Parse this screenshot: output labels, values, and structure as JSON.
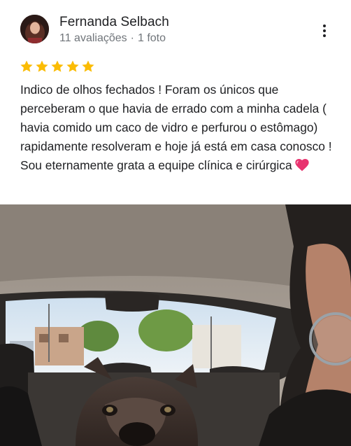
{
  "review": {
    "author_name": "Fernanda Selbach",
    "review_count": "11 avaliações",
    "separator": "·",
    "photo_count": "1 foto",
    "rating": 5,
    "max_rating": 5,
    "text": "Indico de olhos fechados ! Foram os únicos que perceberam o que havia de errado com a minha cadela ( havia comido um caco de vidro e perfurou o estômago) rapidamente resolveram e hoje já está em casa conosco ! Sou eternamente grata a equipe clínica e cirúrgica",
    "emoji": "heart-icon"
  },
  "icons": {
    "more": "more-vert-icon",
    "star": "star-icon",
    "heart": "heart-icon"
  },
  "colors": {
    "star": "#fbbc04",
    "heart": "#e8336f",
    "meta_text": "#70757a",
    "text": "#202124"
  }
}
